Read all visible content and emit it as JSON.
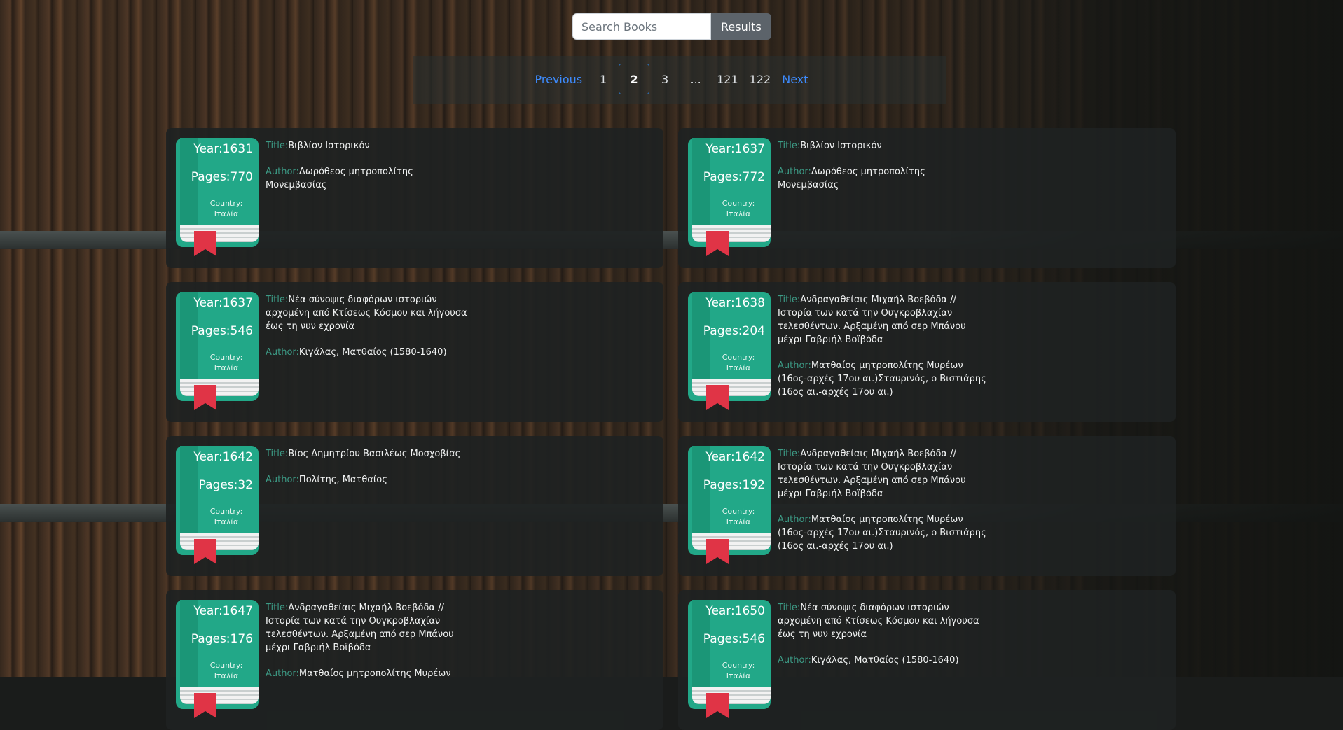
{
  "search": {
    "placeholder": "Search Books",
    "results_label": "Results"
  },
  "pagination": {
    "previous": "Previous",
    "pages": [
      "1",
      "2",
      "3",
      "...",
      "121",
      "122"
    ],
    "active_page": "2",
    "next": "Next"
  },
  "labels": {
    "year": "Year:",
    "pages": "Pages:",
    "country": "Country:",
    "title": "Title:",
    "author": "Author:"
  },
  "books": [
    {
      "year": "1631",
      "pages": "770",
      "country": "Ιταλία",
      "title": "Βιβλίον Ιστορικόν",
      "author": "Δωρόθεος μητροπολίτης Μονεμβασίας"
    },
    {
      "year": "1637",
      "pages": "772",
      "country": "Ιταλία",
      "title": "Βιβλίον Ιστορικόν",
      "author": "Δωρόθεος μητροπολίτης Μονεμβασίας"
    },
    {
      "year": "1637",
      "pages": "546",
      "country": "Ιταλία",
      "title": "Νέα σύνοψις διαφόρων ιστοριών αρχομένη από Κτίσεως Κόσμου και λήγουσα έως τη νυν εχρονία",
      "author": "Κιγάλας, Ματθαίος (1580-1640)"
    },
    {
      "year": "1638",
      "pages": "204",
      "country": "Ιταλία",
      "title": "Ανδραγαθείαις Μιχαήλ Βοεβόδα // Ιστορία των κατά την Ουγκροβλαχίαν τελεσθέντων. Αρξαμένη από σερ Μπάνου μέχρι Γαβριήλ Βοϊβόδα",
      "author": "Ματθαίος μητροπολίτης Μυρέων (16ος-αρχές 17ου αι.)Σταυρινός, ο Βιστιάρης (16ος αι.-αρχές 17ου αι.)"
    },
    {
      "year": "1642",
      "pages": "32",
      "country": "Ιταλία",
      "title": "Βίος Δημητρίου Βασιλέως Μοσχοβίας",
      "author": "Πολίτης, Ματθαίος"
    },
    {
      "year": "1642",
      "pages": "192",
      "country": "Ιταλία",
      "title": "Ανδραγαθείαις Μιχαήλ Βοεβόδα // Ιστορία των κατά την Ουγκροβλαχίαν τελεσθέντων. Αρξαμένη από σερ Μπάνου μέχρι Γαβριήλ Βοϊβόδα",
      "author": "Ματθαίος μητροπολίτης Μυρέων (16ος-αρχές 17ου αι.)Σταυρινός, ο Βιστιάρης (16ος αι.-αρχές 17ου αι.)"
    },
    {
      "year": "1647",
      "pages": "176",
      "country": "Ιταλία",
      "title": "Ανδραγαθείαις Μιχαήλ Βοεβόδα // Ιστορία των κατά την Ουγκροβλαχίαν τελεσθέντων. Αρξαμένη από σερ Μπάνου μέχρι Γαβριήλ Βοϊβόδα",
      "author": "Ματθαίος μητροπολίτης Μυρέων"
    },
    {
      "year": "1650",
      "pages": "546",
      "country": "Ιταλία",
      "title": "Νέα σύνοψις διαφόρων ιστοριών αρχομένη από Κτίσεως Κόσμου και λήγουσα έως τη νυν εχρονία",
      "author": "Κιγάλας, Ματθαίος (1580-1640)"
    }
  ]
}
